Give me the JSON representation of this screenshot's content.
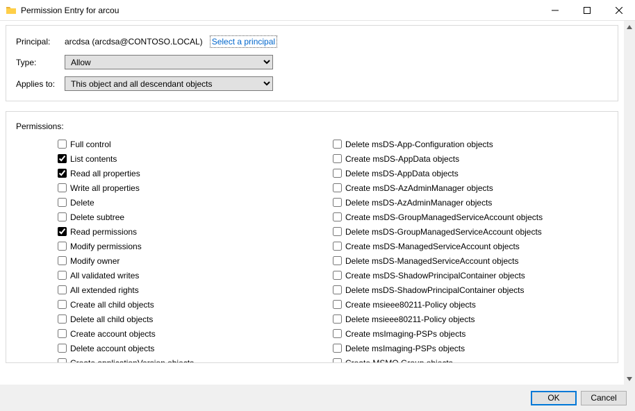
{
  "title": "Permission Entry for arcou",
  "header": {
    "principal_label": "Principal:",
    "principal_value": "arcdsa (arcdsa@CONTOSO.LOCAL)",
    "select_link": "Select a principal",
    "type_label": "Type:",
    "type_value": "Allow",
    "applies_label": "Applies to:",
    "applies_value": "This object and all descendant objects"
  },
  "permissions_label": "Permissions:",
  "permissions_left": [
    {
      "label": "Full control",
      "checked": false
    },
    {
      "label": "List contents",
      "checked": true
    },
    {
      "label": "Read all properties",
      "checked": true
    },
    {
      "label": "Write all properties",
      "checked": false
    },
    {
      "label": "Delete",
      "checked": false
    },
    {
      "label": "Delete subtree",
      "checked": false
    },
    {
      "label": "Read permissions",
      "checked": true
    },
    {
      "label": "Modify permissions",
      "checked": false
    },
    {
      "label": "Modify owner",
      "checked": false
    },
    {
      "label": "All validated writes",
      "checked": false
    },
    {
      "label": "All extended rights",
      "checked": false
    },
    {
      "label": "Create all child objects",
      "checked": false
    },
    {
      "label": "Delete all child objects",
      "checked": false
    },
    {
      "label": "Create account objects",
      "checked": false
    },
    {
      "label": "Delete account objects",
      "checked": false
    },
    {
      "label": "Create applicationVersion objects",
      "checked": false
    }
  ],
  "permissions_right": [
    {
      "label": "Delete msDS-App-Configuration objects",
      "checked": false
    },
    {
      "label": "Create msDS-AppData objects",
      "checked": false
    },
    {
      "label": "Delete msDS-AppData objects",
      "checked": false
    },
    {
      "label": "Create msDS-AzAdminManager objects",
      "checked": false
    },
    {
      "label": "Delete msDS-AzAdminManager objects",
      "checked": false
    },
    {
      "label": "Create msDS-GroupManagedServiceAccount objects",
      "checked": false
    },
    {
      "label": "Delete msDS-GroupManagedServiceAccount objects",
      "checked": false
    },
    {
      "label": "Create msDS-ManagedServiceAccount objects",
      "checked": false
    },
    {
      "label": "Delete msDS-ManagedServiceAccount objects",
      "checked": false
    },
    {
      "label": "Create msDS-ShadowPrincipalContainer objects",
      "checked": false
    },
    {
      "label": "Delete msDS-ShadowPrincipalContainer objects",
      "checked": false
    },
    {
      "label": "Create msieee80211-Policy objects",
      "checked": false
    },
    {
      "label": "Delete msieee80211-Policy objects",
      "checked": false
    },
    {
      "label": "Create msImaging-PSPs objects",
      "checked": false
    },
    {
      "label": "Delete msImaging-PSPs objects",
      "checked": false
    },
    {
      "label": "Create MSMQ Group objects",
      "checked": false
    }
  ],
  "buttons": {
    "ok": "OK",
    "cancel": "Cancel"
  }
}
